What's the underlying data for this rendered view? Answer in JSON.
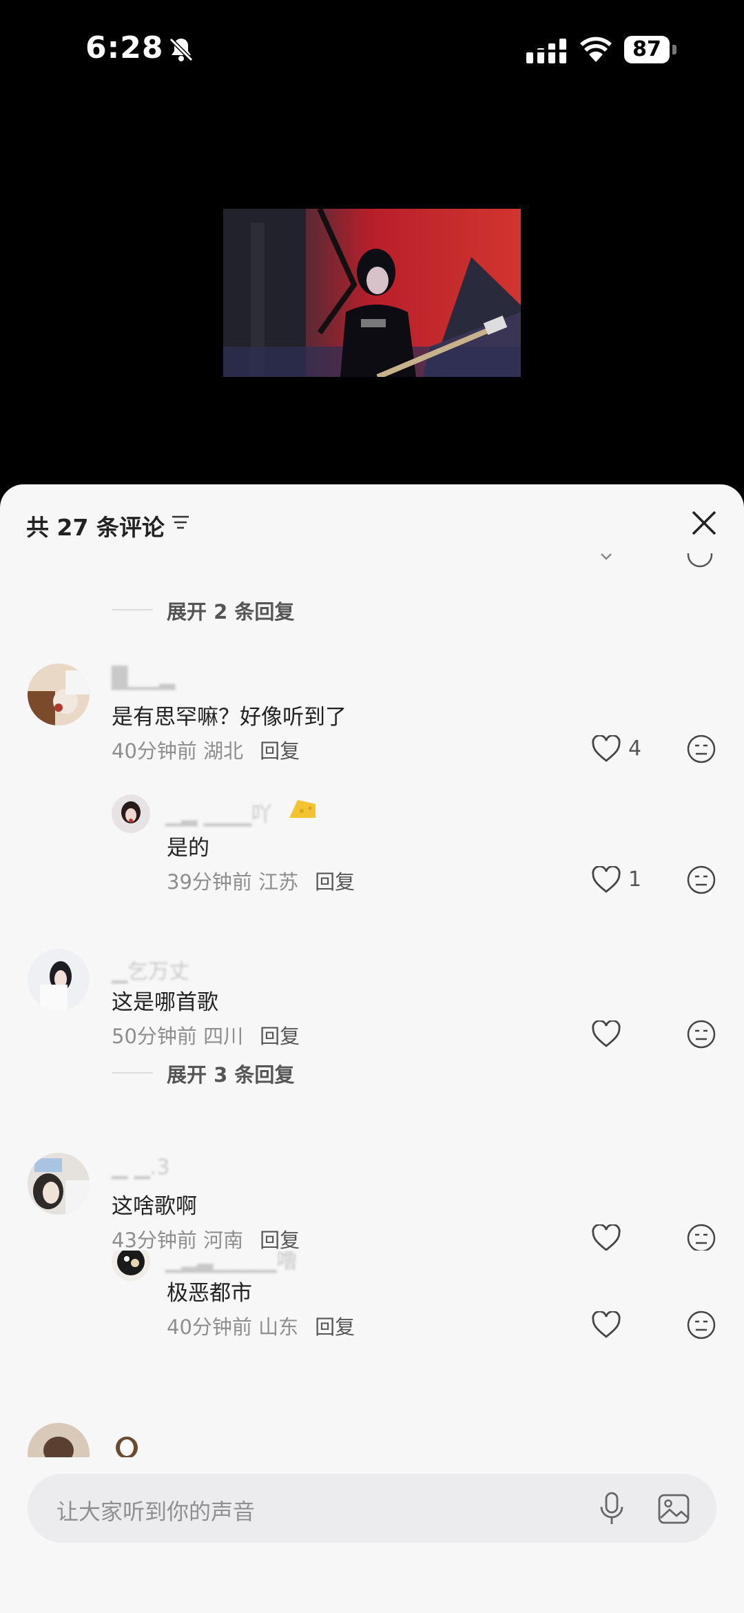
{
  "status_bar": {
    "time": "6:28",
    "battery": "87",
    "icons": [
      "bell-slash-icon",
      "signal-icon",
      "wifi-icon",
      "battery-icon"
    ]
  },
  "colors": {
    "sheet_bg": "#f7f7f8",
    "video_accent": "#c0202a"
  },
  "comments_sheet": {
    "title": "共 27 条评论",
    "expand_2": "展开 2 条回复",
    "expand_3": "展开 3 条回复",
    "comments": [
      {
        "text": "是有思罕嘛？好像听到了",
        "time": "40分钟前",
        "location": "湖北",
        "reply": "回复",
        "likes": "4",
        "replies": [
          {
            "text": "是的",
            "time": "39分钟前",
            "location": "江苏",
            "reply": "回复",
            "likes": "1"
          }
        ]
      },
      {
        "text": "这是哪首歌",
        "time": "50分钟前",
        "location": "四川",
        "reply": "回复",
        "likes": ""
      },
      {
        "text": "这啥歌啊",
        "time": "43分钟前",
        "location": "河南",
        "reply": "回复",
        "likes": "",
        "replies": [
          {
            "text": "极恶都市",
            "time": "40分钟前",
            "location": "山东",
            "reply": "回复",
            "likes": ""
          }
        ]
      }
    ]
  },
  "input": {
    "placeholder": "让大家听到你的声音",
    "icons": [
      "microphone-icon",
      "image-icon"
    ]
  }
}
